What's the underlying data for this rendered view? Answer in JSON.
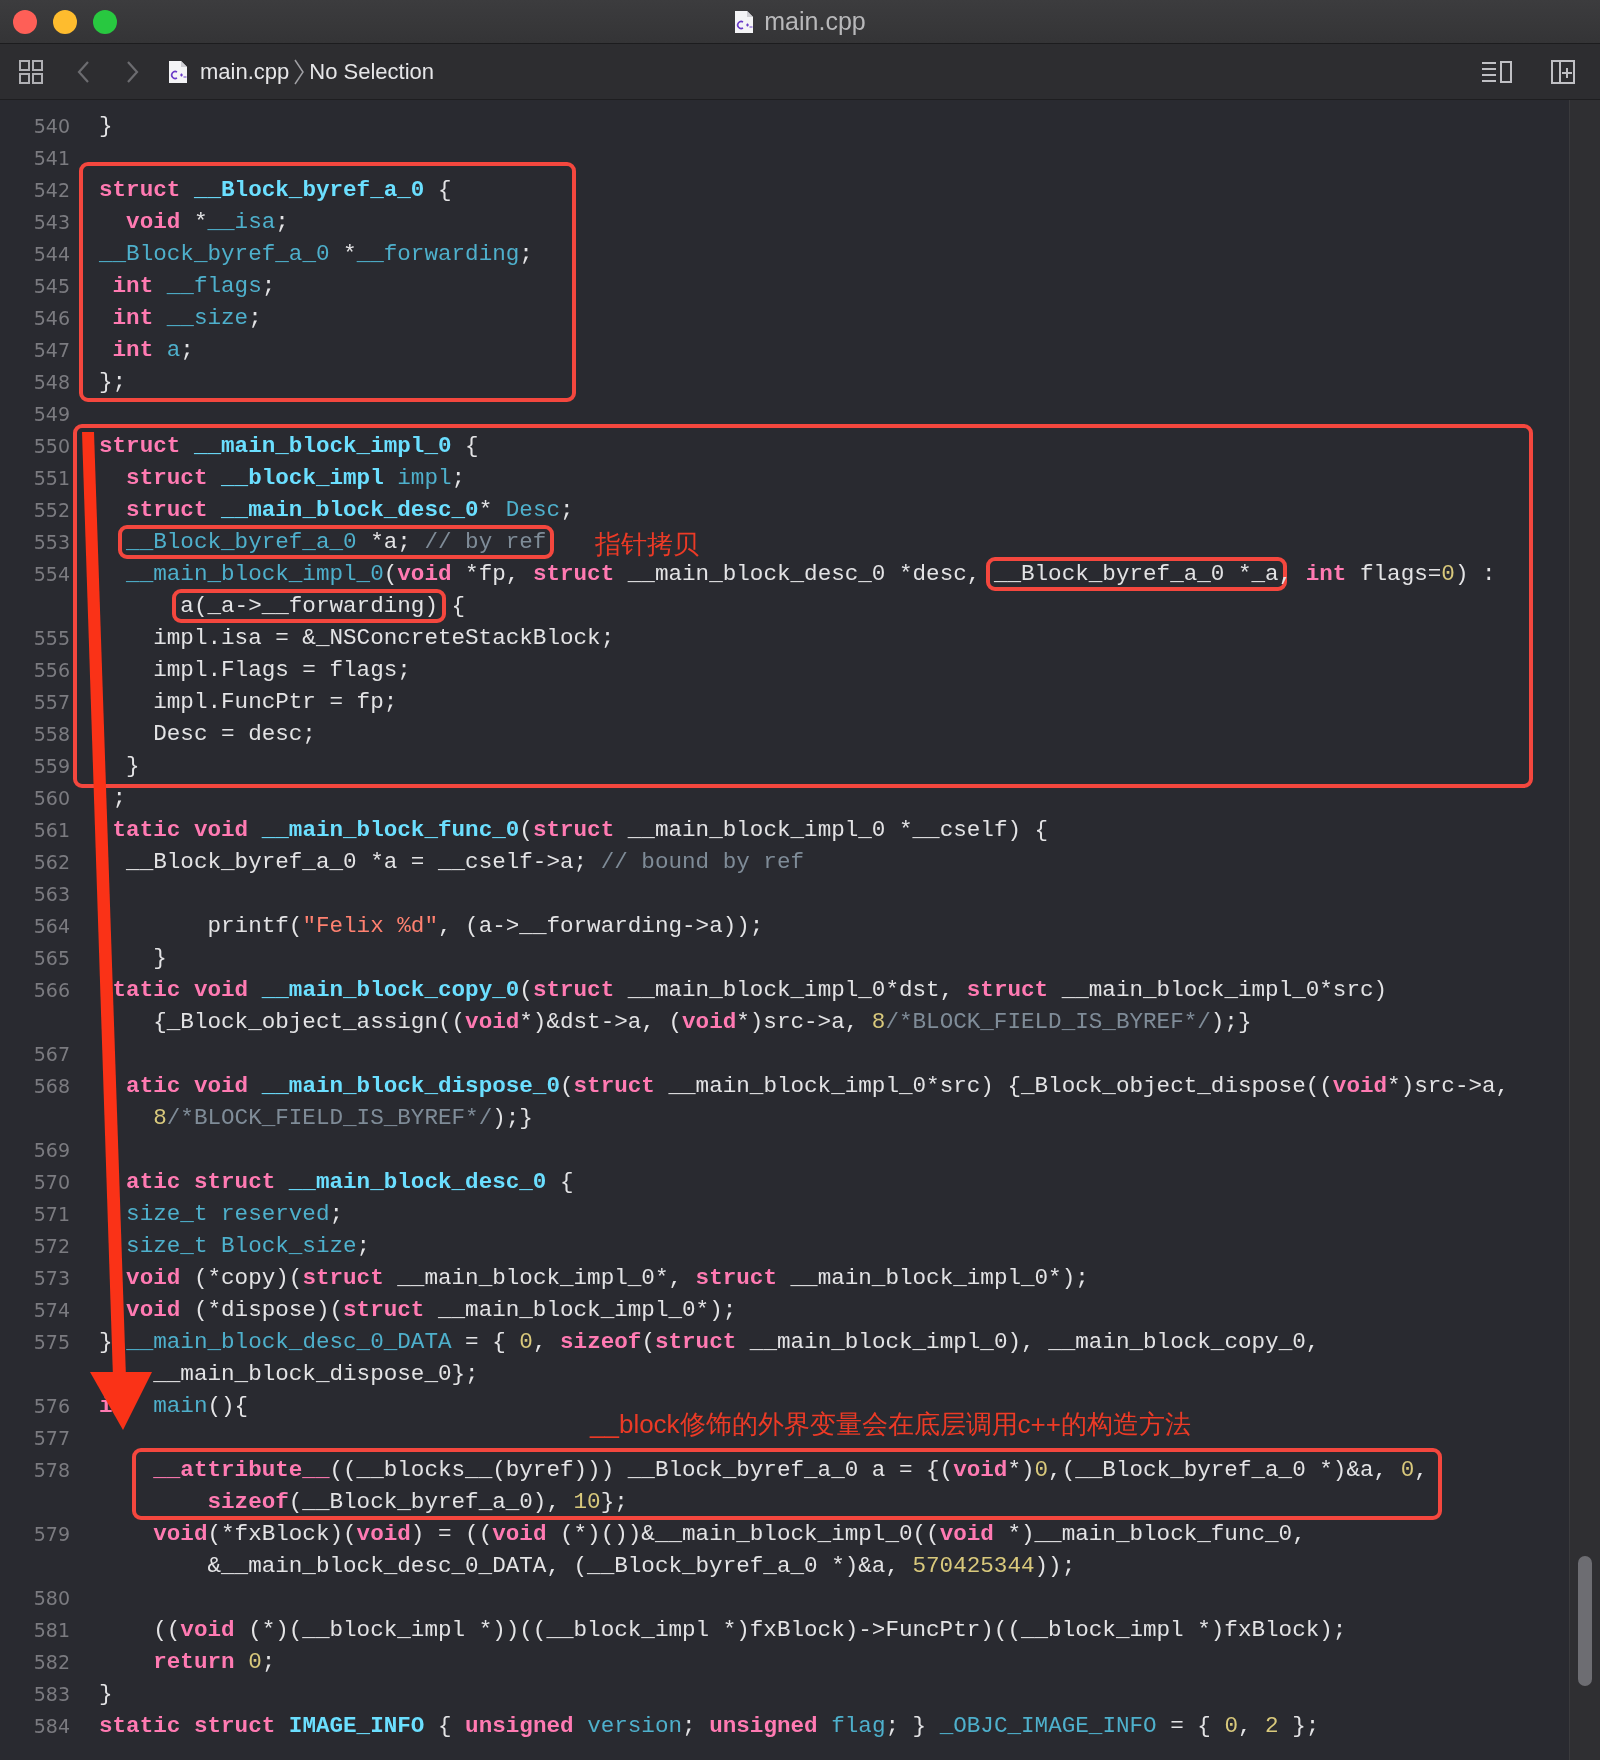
{
  "window": {
    "title": "main.cpp"
  },
  "breadcrumbs": [
    {
      "kind": "file",
      "text": "main.cpp"
    },
    {
      "kind": "symbol",
      "text": "No Selection"
    }
  ],
  "editor": {
    "lines": [
      {
        "number": "540",
        "tokens": [
          {
            "kind": "plain",
            "text": "}"
          }
        ]
      },
      {
        "number": "541"
      },
      {
        "number": "542",
        "tokens": [
          {
            "kind": "keyword",
            "text": "struct "
          },
          {
            "kind": "type",
            "text": "__Block_byref_a_0"
          },
          {
            "kind": "plain",
            "text": " {"
          }
        ]
      },
      {
        "number": "543",
        "tokens": [
          {
            "kind": "keyword",
            "text": "  void"
          },
          {
            "kind": "plain",
            "text": " *"
          },
          {
            "kind": "name",
            "text": "__isa"
          },
          {
            "kind": "plain",
            "text": ";"
          }
        ]
      },
      {
        "number": "544",
        "tokens": [
          {
            "kind": "name",
            "text": "__Block_byref_a_0"
          },
          {
            "kind": "plain",
            "text": " *"
          },
          {
            "kind": "name",
            "text": "__forwarding"
          },
          {
            "kind": "plain",
            "text": ";"
          }
        ]
      },
      {
        "number": "545",
        "tokens": [
          {
            "kind": "keyword",
            "text": " int "
          },
          {
            "kind": "name",
            "text": "__flags"
          },
          {
            "kind": "plain",
            "text": ";"
          }
        ]
      },
      {
        "number": "546",
        "tokens": [
          {
            "kind": "keyword",
            "text": " int "
          },
          {
            "kind": "name",
            "text": "__size"
          },
          {
            "kind": "plain",
            "text": ";"
          }
        ]
      },
      {
        "number": "547",
        "tokens": [
          {
            "kind": "keyword",
            "text": " int "
          },
          {
            "kind": "name",
            "text": "a"
          },
          {
            "kind": "plain",
            "text": ";"
          }
        ]
      },
      {
        "number": "548",
        "tokens": [
          {
            "kind": "plain",
            "text": "};"
          }
        ]
      },
      {
        "number": "549"
      },
      {
        "number": "550",
        "tokens": [
          {
            "kind": "keyword",
            "text": "struct "
          },
          {
            "kind": "type",
            "text": "__main_block_impl_0"
          },
          {
            "kind": "plain",
            "text": " {"
          }
        ]
      },
      {
        "number": "551",
        "tokens": [
          {
            "kind": "keyword",
            "text": "  struct "
          },
          {
            "kind": "type",
            "text": "__block_impl "
          },
          {
            "kind": "name",
            "text": "impl"
          },
          {
            "kind": "plain",
            "text": ";"
          }
        ]
      },
      {
        "number": "552",
        "tokens": [
          {
            "kind": "keyword",
            "text": "  struct "
          },
          {
            "kind": "type",
            "text": "__main_block_desc_0"
          },
          {
            "kind": "plain",
            "text": "* "
          },
          {
            "kind": "name",
            "text": "Desc"
          },
          {
            "kind": "plain",
            "text": ";"
          }
        ]
      },
      {
        "number": "553",
        "tokens": [
          {
            "kind": "name",
            "text": "  __Block_byref_a_0",
            "framed": true
          },
          {
            "kind": "plain",
            "text": " *a; ",
            "framed": true
          },
          {
            "kind": "comment",
            "text": "// by ref",
            "framed": true
          }
        ]
      },
      {
        "number": "554",
        "tokens": [
          {
            "kind": "name",
            "text": "  __main_block_impl_0"
          },
          {
            "kind": "plain",
            "text": "("
          },
          {
            "kind": "keyword",
            "text": "void"
          },
          {
            "kind": "plain",
            "text": " *fp, "
          },
          {
            "kind": "keyword",
            "text": "struct"
          },
          {
            "kind": "plain",
            "text": " __main_block_desc_0 *desc, "
          },
          {
            "kind": "plain",
            "text": "__Block_byref_a_0 *_a",
            "framed": true
          },
          {
            "kind": "plain",
            "text": ", "
          },
          {
            "kind": "keyword",
            "text": "int"
          },
          {
            "kind": "plain",
            "text": " flags="
          },
          {
            "kind": "number",
            "text": "0"
          },
          {
            "kind": "plain",
            "text": ") :"
          }
        ]
      },
      {
        "tokens": [
          {
            "kind": "plain",
            "text": "      a(_a->__forwarding)",
            "framed": true
          },
          {
            "kind": "plain",
            "text": " {"
          }
        ]
      },
      {
        "number": "555",
        "tokens": [
          {
            "kind": "plain",
            "text": "    impl.isa = &_NSConcreteStackBlock;"
          }
        ]
      },
      {
        "number": "556",
        "tokens": [
          {
            "kind": "plain",
            "text": "    impl.Flags = flags;"
          }
        ]
      },
      {
        "number": "557",
        "tokens": [
          {
            "kind": "plain",
            "text": "    impl.FuncPtr = fp;"
          }
        ]
      },
      {
        "number": "558",
        "tokens": [
          {
            "kind": "plain",
            "text": "    Desc = desc;"
          }
        ]
      },
      {
        "number": "559",
        "tokens": [
          {
            "kind": "plain",
            "text": "  }"
          }
        ]
      },
      {
        "number": "560",
        "tokens": [
          {
            "kind": "plain",
            "text": " ;"
          }
        ]
      },
      {
        "number": "561",
        "tokens": [
          {
            "kind": "keyword",
            "text": " tatic void "
          },
          {
            "kind": "type",
            "text": "__main_block_func_0"
          },
          {
            "kind": "plain",
            "text": "("
          },
          {
            "kind": "keyword",
            "text": "struct"
          },
          {
            "kind": "plain",
            "text": " __main_block_impl_0 *__cself) {"
          }
        ]
      },
      {
        "number": "562",
        "tokens": [
          {
            "kind": "plain",
            "text": "  __Block_byref_a_0 *a = __cself->a; "
          },
          {
            "kind": "comment",
            "text": "// bound by ref"
          }
        ]
      },
      {
        "number": "563"
      },
      {
        "number": "564",
        "tokens": [
          {
            "kind": "plain",
            "text": "        printf("
          },
          {
            "kind": "string",
            "text": "\"Felix %d\""
          },
          {
            "kind": "plain",
            "text": ", (a->__forwarding->a));"
          }
        ]
      },
      {
        "number": "565",
        "tokens": [
          {
            "kind": "plain",
            "text": "    }"
          }
        ]
      },
      {
        "number": "566",
        "tokens": [
          {
            "kind": "keyword",
            "text": " tatic void "
          },
          {
            "kind": "type",
            "text": "__main_block_copy_0"
          },
          {
            "kind": "plain",
            "text": "("
          },
          {
            "kind": "keyword",
            "text": "struct"
          },
          {
            "kind": "plain",
            "text": " __main_block_impl_0*dst, "
          },
          {
            "kind": "keyword",
            "text": "struct"
          },
          {
            "kind": "plain",
            "text": " __main_block_impl_0*src)"
          }
        ]
      },
      {
        "tokens": [
          {
            "kind": "plain",
            "text": "    {_Block_object_assign(("
          },
          {
            "kind": "keyword",
            "text": "void"
          },
          {
            "kind": "plain",
            "text": "*)&dst->a, ("
          },
          {
            "kind": "keyword",
            "text": "void"
          },
          {
            "kind": "plain",
            "text": "*)src->a, "
          },
          {
            "kind": "number",
            "text": "8"
          },
          {
            "kind": "comment",
            "text": "/*BLOCK_FIELD_IS_BYREF*/"
          },
          {
            "kind": "plain",
            "text": ");}"
          }
        ]
      },
      {
        "number": "567"
      },
      {
        "number": "568",
        "tokens": [
          {
            "kind": "keyword",
            "text": "  atic void "
          },
          {
            "kind": "type",
            "text": "__main_block_dispose_0"
          },
          {
            "kind": "plain",
            "text": "("
          },
          {
            "kind": "keyword",
            "text": "struct"
          },
          {
            "kind": "plain",
            "text": " __main_block_impl_0*src) {_Block_object_dispose(("
          },
          {
            "kind": "keyword",
            "text": "void"
          },
          {
            "kind": "plain",
            "text": "*)src->a,"
          }
        ]
      },
      {
        "tokens": [
          {
            "kind": "number",
            "text": "    8"
          },
          {
            "kind": "comment",
            "text": "/*BLOCK_FIELD_IS_BYREF*/"
          },
          {
            "kind": "plain",
            "text": ");}"
          }
        ]
      },
      {
        "number": "569"
      },
      {
        "number": "570",
        "tokens": [
          {
            "kind": "keyword",
            "text": "  atic struct "
          },
          {
            "kind": "type",
            "text": "__main_block_desc_0"
          },
          {
            "kind": "plain",
            "text": " {"
          }
        ]
      },
      {
        "number": "571",
        "tokens": [
          {
            "kind": "name",
            "text": "  size_t reserved"
          },
          {
            "kind": "plain",
            "text": ";"
          }
        ]
      },
      {
        "number": "572",
        "tokens": [
          {
            "kind": "name",
            "text": "  size_t Block_size"
          },
          {
            "kind": "plain",
            "text": ";"
          }
        ]
      },
      {
        "number": "573",
        "tokens": [
          {
            "kind": "keyword",
            "text": "  void"
          },
          {
            "kind": "plain",
            "text": " (*copy)("
          },
          {
            "kind": "keyword",
            "text": "struct"
          },
          {
            "kind": "plain",
            "text": " __main_block_impl_0*, "
          },
          {
            "kind": "keyword",
            "text": "struct"
          },
          {
            "kind": "plain",
            "text": " __main_block_impl_0*);"
          }
        ]
      },
      {
        "number": "574",
        "tokens": [
          {
            "kind": "keyword",
            "text": "  void"
          },
          {
            "kind": "plain",
            "text": " (*dispose)("
          },
          {
            "kind": "keyword",
            "text": "struct"
          },
          {
            "kind": "plain",
            "text": " __main_block_impl_0*);"
          }
        ]
      },
      {
        "number": "575",
        "tokens": [
          {
            "kind": "plain",
            "text": "} "
          },
          {
            "kind": "name",
            "text": "__main_block_desc_0_DATA"
          },
          {
            "kind": "plain",
            "text": " = { "
          },
          {
            "kind": "number",
            "text": "0"
          },
          {
            "kind": "plain",
            "text": ", "
          },
          {
            "kind": "keyword",
            "text": "sizeof"
          },
          {
            "kind": "plain",
            "text": "("
          },
          {
            "kind": "keyword",
            "text": "struct"
          },
          {
            "kind": "plain",
            "text": " __main_block_impl_0), __main_block_copy_0,"
          }
        ]
      },
      {
        "tokens": [
          {
            "kind": "plain",
            "text": "    __main_block_dispose_0};"
          }
        ]
      },
      {
        "number": "576",
        "tokens": [
          {
            "kind": "keyword",
            "text": "i   "
          },
          {
            "kind": "name",
            "text": "main"
          },
          {
            "kind": "plain",
            "text": "(){"
          }
        ]
      },
      {
        "number": "577"
      },
      {
        "number": "578",
        "tokens": [
          {
            "kind": "keyword",
            "text": "    __attribute__"
          },
          {
            "kind": "plain",
            "text": "((__blocks__(byref))) __Block_byref_a_0 a = {("
          },
          {
            "kind": "keyword",
            "text": "void"
          },
          {
            "kind": "plain",
            "text": "*)"
          },
          {
            "kind": "number",
            "text": "0"
          },
          {
            "kind": "plain",
            "text": ",(__Block_byref_a_0 *)&a, "
          },
          {
            "kind": "number",
            "text": "0"
          },
          {
            "kind": "plain",
            "text": ","
          }
        ]
      },
      {
        "tokens": [
          {
            "kind": "keyword",
            "text": "        sizeof"
          },
          {
            "kind": "plain",
            "text": "(__Block_byref_a_0), "
          },
          {
            "kind": "number",
            "text": "10"
          },
          {
            "kind": "plain",
            "text": "};"
          }
        ]
      },
      {
        "number": "579",
        "tokens": [
          {
            "kind": "keyword",
            "text": "    void"
          },
          {
            "kind": "plain",
            "text": "(*fxBlock)("
          },
          {
            "kind": "keyword",
            "text": "void"
          },
          {
            "kind": "plain",
            "text": ") = (("
          },
          {
            "kind": "keyword",
            "text": "void"
          },
          {
            "kind": "plain",
            "text": " (*)())&__main_block_impl_0(("
          },
          {
            "kind": "keyword",
            "text": "void"
          },
          {
            "kind": "plain",
            "text": " *)__main_block_func_0,"
          }
        ]
      },
      {
        "tokens": [
          {
            "kind": "plain",
            "text": "        &__main_block_desc_0_DATA, (__Block_byref_a_0 *)&a, "
          },
          {
            "kind": "number",
            "text": "570425344"
          },
          {
            "kind": "plain",
            "text": "));"
          }
        ]
      },
      {
        "number": "580"
      },
      {
        "number": "581",
        "tokens": [
          {
            "kind": "plain",
            "text": "    (("
          },
          {
            "kind": "keyword",
            "text": "void"
          },
          {
            "kind": "plain",
            "text": " (*)(__block_impl *))((__block_impl *)fxBlock)->FuncPtr)((__block_impl *)fxBlock);"
          }
        ]
      },
      {
        "number": "582",
        "tokens": [
          {
            "kind": "keyword",
            "text": "    return "
          },
          {
            "kind": "number",
            "text": "0"
          },
          {
            "kind": "plain",
            "text": ";"
          }
        ]
      },
      {
        "number": "583",
        "tokens": [
          {
            "kind": "plain",
            "text": "}"
          }
        ]
      },
      {
        "number": "584",
        "tokens": [
          {
            "kind": "keyword",
            "text": "static struct "
          },
          {
            "kind": "type",
            "text": "IMAGE_INFO"
          },
          {
            "kind": "plain",
            "text": " { "
          },
          {
            "kind": "keyword",
            "text": "unsigned "
          },
          {
            "kind": "name",
            "text": "version"
          },
          {
            "kind": "plain",
            "text": "; "
          },
          {
            "kind": "keyword",
            "text": "unsigned "
          },
          {
            "kind": "name",
            "text": "flag"
          },
          {
            "kind": "plain",
            "text": "; } "
          },
          {
            "kind": "name",
            "text": "_OBJC_IMAGE_INFO"
          },
          {
            "kind": "plain",
            "text": " = { "
          },
          {
            "kind": "number",
            "text": "0"
          },
          {
            "kind": "plain",
            "text": ", "
          },
          {
            "kind": "number",
            "text": "2"
          },
          {
            "kind": "plain",
            "text": " };"
          }
        ]
      }
    ]
  },
  "annotations": [
    {
      "text": "指针拷贝"
    },
    {
      "text": "__block修饰的外界变量会在底层调用c++的构造方法"
    }
  ]
}
